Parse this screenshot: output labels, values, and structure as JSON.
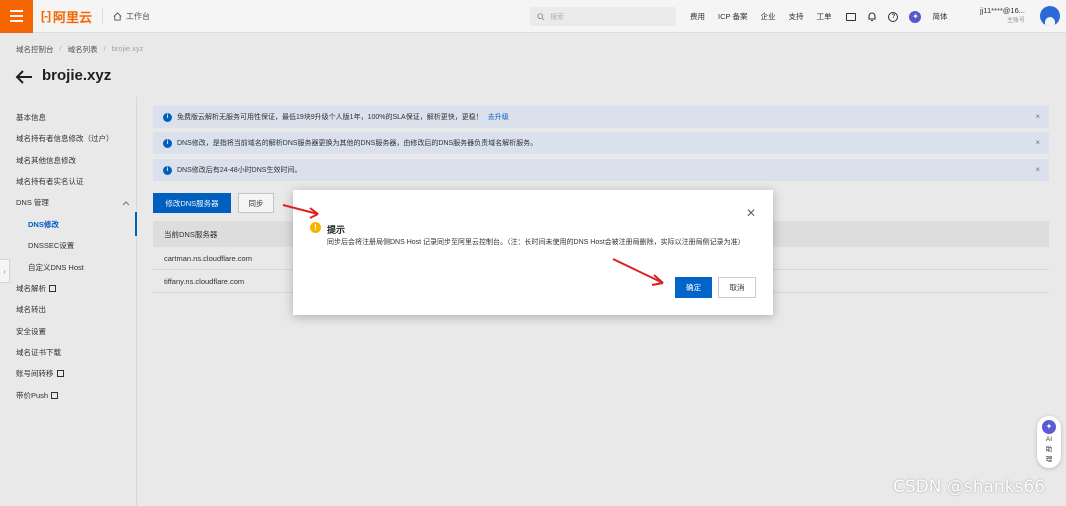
{
  "topbar": {
    "logo": "阿里云",
    "logo_mark": "[-]",
    "workbench": "工作台",
    "search_placeholder": "搜索",
    "nav": [
      "费用",
      "ICP 备案",
      "企业",
      "支持",
      "工单"
    ],
    "lang": "简体",
    "user_name": "jj11****@16...",
    "user_role": "主账号"
  },
  "breadcrumb": [
    "域名控制台",
    "域名列表",
    "brojie.xyz"
  ],
  "page_title": "brojie.xyz",
  "sidebar": {
    "items": [
      {
        "label": "基本信息"
      },
      {
        "label": "域名持有者信息修改（过户）"
      },
      {
        "label": "域名其他信息修改"
      },
      {
        "label": "域名持有者实名认证"
      },
      {
        "label": "DNS 管理"
      },
      {
        "label": "DNS修改"
      },
      {
        "label": "DNSSEC设置"
      },
      {
        "label": "自定义DNS Host"
      },
      {
        "label": "域名解析"
      },
      {
        "label": "域名转出"
      },
      {
        "label": "安全设置"
      },
      {
        "label": "域名证书下载"
      },
      {
        "label": "账号间转移"
      },
      {
        "label": "带价Push"
      }
    ]
  },
  "alerts": [
    {
      "text": "免费版云解析无服务可用性保证，最低19块9升级个人版1年，100%的SLA保证，解析更快，更稳！",
      "link": "去升级"
    },
    {
      "text": "DNS修改，是指将当前域名的解析DNS服务器更换为其他的DNS服务器，由修改后的DNS服务器负责域名解析服务。"
    },
    {
      "text": "DNS修改后有24-48小时DNS生效时间。"
    }
  ],
  "actions": {
    "modify_dns": "修改DNS服务器",
    "sync": "同步"
  },
  "table": {
    "header": "当前DNS服务器",
    "rows": [
      "cartman.ns.cloudflare.com",
      "tiffany.ns.cloudflare.com"
    ]
  },
  "modal": {
    "title": "提示",
    "body": "同步后会将注册局侧DNS Host 记录同步至阿里云控制台。（注：长时间未使用的DNS Host会被注册局删除，实际以注册局侧记录为准）",
    "ok": "确定",
    "cancel": "取消"
  },
  "ai_assistant": {
    "line1": "AI",
    "line2": "助",
    "line3": "理"
  },
  "watermark": "CSDN @shanks66",
  "colors": {
    "brand": "#ff6a00",
    "primary": "#0064c8",
    "warning": "#f5b400",
    "annotation": "#e02020"
  }
}
